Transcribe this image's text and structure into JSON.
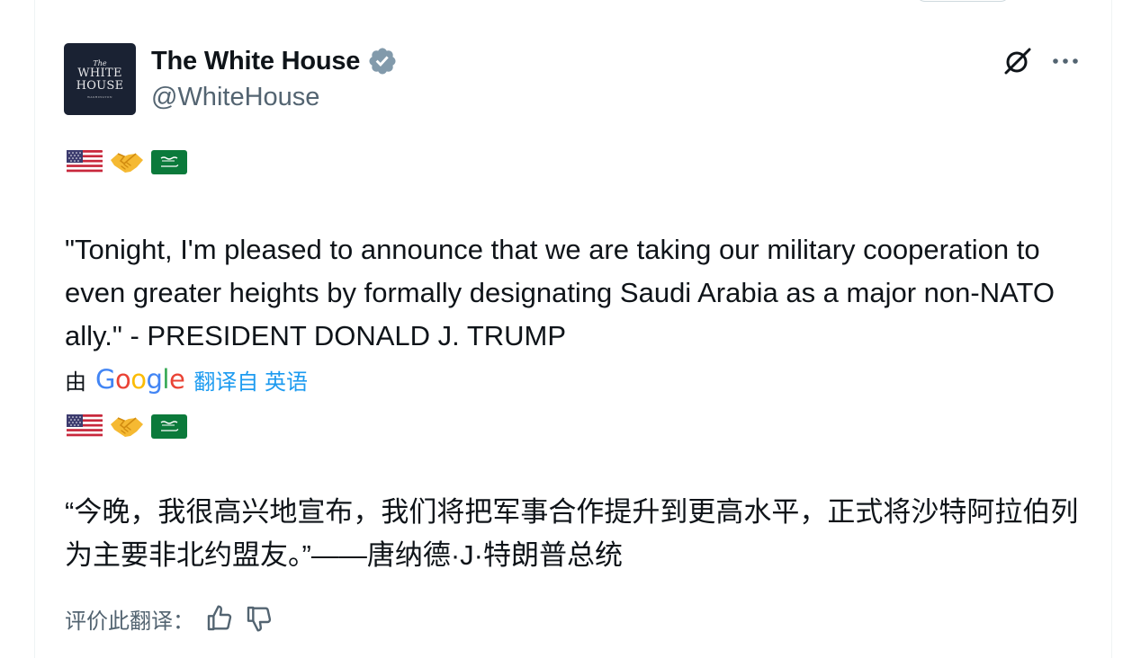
{
  "tweet": {
    "author": {
      "display_name": "The White House",
      "handle": "@WhiteHouse",
      "avatar_text": {
        "line1": "The",
        "line2": "WHITE",
        "line3": "HOUSE",
        "line4": "WASHINGTON"
      }
    },
    "emojis": [
      "us-flag",
      "handshake",
      "saudi-flag"
    ],
    "text": "\"Tonight, I'm pleased to announce that we are taking our military cooperation to even greater heights by formally designating Saudi Arabia as a major non-NATO ally.\" - PRESIDENT DONALD J. TRUMP",
    "translation": {
      "by_label": "由",
      "provider": "Google",
      "from_label": "翻译自 英语",
      "text": "“今晚，我很高兴地宣布，我们将把军事合作提升到更高水平，正式将沙特阿拉伯列为主要非北约盟友。”——唐纳德·J·特朗普总统",
      "rate_label": "评价此翻译："
    }
  },
  "colors": {
    "text_primary": "#0f1419",
    "text_secondary": "#536471",
    "link": "#1d9bf0",
    "verified_badge": "#829aab",
    "avatar_bg": "#1a2233"
  },
  "icons": {
    "verified": "verified-badge-icon",
    "grok": "grok-icon",
    "more": "more-options-icon",
    "thumbs_up": "thumbs-up-icon",
    "thumbs_down": "thumbs-down-icon"
  }
}
